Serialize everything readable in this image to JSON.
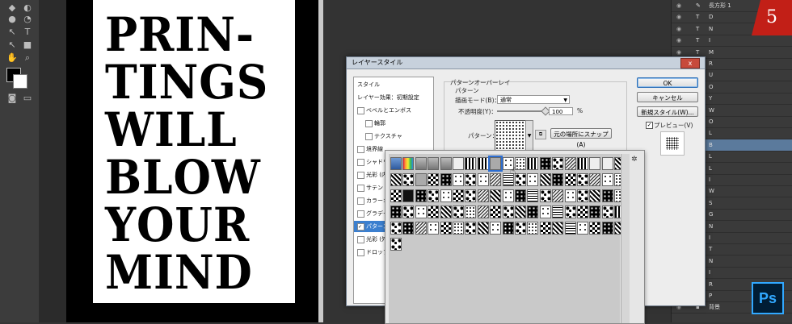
{
  "poster": {
    "lines": [
      "PRIN-",
      "TINGS",
      "WILL",
      "BLOW",
      "YOUR",
      "MIND"
    ]
  },
  "dialog": {
    "title": "レイヤースタイル",
    "close": "x",
    "style_list": [
      "スタイル",
      "レイヤー効果：初期設定",
      "ベベルとエンボス",
      "輪郭",
      "テクスチャ",
      "境界線",
      "シャドウ(内側)",
      "光彩 (内側)",
      "サテン",
      "カラーオーバーレイ",
      "グラデーションオーバーレイ",
      "パターンオーバーレイ",
      "光彩 (外側)",
      "ドロップシャドウ"
    ],
    "selected_style": "パターンオーバーレイ",
    "panel_title": "パターンオーバーレイ",
    "panel_sub": "パターン",
    "blend_label": "描画モード(B)：",
    "blend_value": "通常",
    "opacity_label": "不透明度(Y)：",
    "opacity_value": "100",
    "opacity_unit": "%",
    "pattern_label": "パターン：",
    "snap_button": "元の場所にスナップ(A)",
    "ok": "OK",
    "cancel": "キャンセル",
    "new_style": "新規スタイル(W)...",
    "preview_label": "プレビュー(V)",
    "preview_checked": true
  },
  "layers": [
    {
      "type": "shape",
      "name": "長方形 1"
    },
    {
      "type": "T",
      "name": "D"
    },
    {
      "type": "T",
      "name": "N"
    },
    {
      "type": "T",
      "name": "I"
    },
    {
      "type": "T",
      "name": "M"
    },
    {
      "type": "T",
      "name": "R"
    },
    {
      "type": "T",
      "name": "U"
    },
    {
      "type": "T",
      "name": "O"
    },
    {
      "type": "T",
      "name": "Y"
    },
    {
      "type": "T",
      "name": "W"
    },
    {
      "type": "T",
      "name": "O"
    },
    {
      "type": "T",
      "name": "L"
    },
    {
      "type": "T",
      "name": "B"
    },
    {
      "type": "T",
      "name": "L"
    },
    {
      "type": "T",
      "name": "L"
    },
    {
      "type": "T",
      "name": "I"
    },
    {
      "type": "T",
      "name": "W"
    },
    {
      "type": "T",
      "name": "S"
    },
    {
      "type": "T",
      "name": "G"
    },
    {
      "type": "T",
      "name": "N"
    },
    {
      "type": "T",
      "name": "I"
    },
    {
      "type": "T",
      "name": "T"
    },
    {
      "type": "T",
      "name": "N"
    },
    {
      "type": "T",
      "name": "I"
    },
    {
      "type": "T",
      "name": "R"
    },
    {
      "type": "T",
      "name": "P"
    },
    {
      "type": "bg",
      "name": "背景"
    }
  ],
  "selected_layer_index": 12,
  "badge": "5",
  "app_logo": "Ps"
}
